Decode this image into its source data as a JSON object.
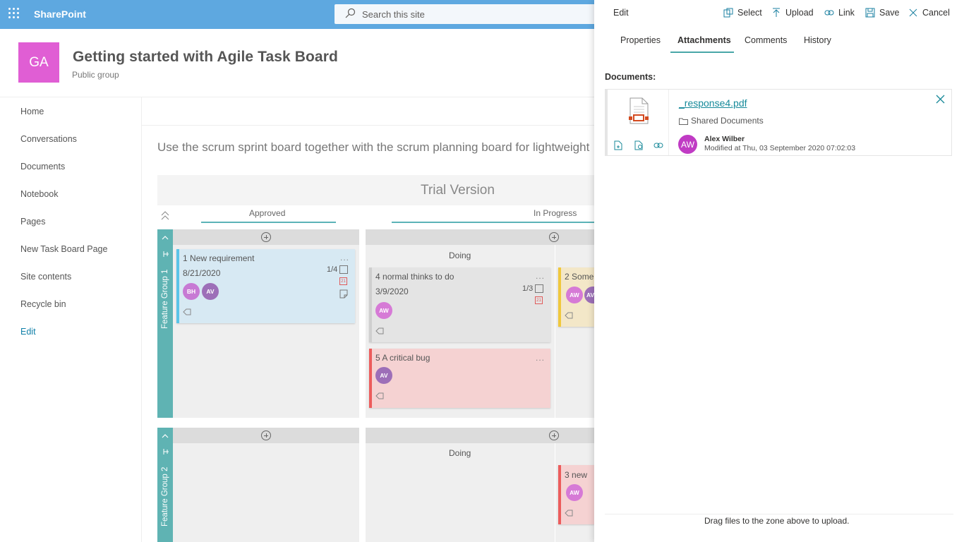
{
  "suite": {
    "brand": "SharePoint",
    "search_placeholder": "Search this site"
  },
  "site": {
    "logo_initials": "GA",
    "title": "Getting started with Agile Task Board",
    "subtitle": "Public group"
  },
  "nav": {
    "items": [
      "Home",
      "Conversations",
      "Documents",
      "Notebook",
      "Pages",
      "New Task Board Page",
      "Site contents",
      "Recycle bin"
    ],
    "edit": "Edit"
  },
  "main": {
    "intro": "Use the scrum sprint board together with the scrum planning board for lightweight",
    "trial": "Trial Version",
    "columns": [
      "Approved",
      "In Progress"
    ],
    "groups": [
      "Feature Group 1",
      "Feature Group 2"
    ],
    "sub_column": "Doing",
    "cards": [
      {
        "num": "1",
        "title": "New requirement",
        "date": "8/21/2020",
        "count": "1/4",
        "avatars": [
          "BH",
          "AV"
        ]
      },
      {
        "num": "4",
        "title": "normal thinks to do",
        "date": "3/9/2020",
        "count": "1/3",
        "avatars": [
          "AW"
        ]
      },
      {
        "num": "5",
        "title": "A critical bug",
        "avatars": [
          "AV"
        ]
      },
      {
        "num": "2",
        "title": "Some",
        "avatars": [
          "AW",
          "AV"
        ]
      },
      {
        "num": "3",
        "title": "new ",
        "avatars": [
          "AW"
        ]
      }
    ],
    "more": "...",
    "cal_day": "21"
  },
  "panel": {
    "edit": "Edit",
    "commands": {
      "select": "Select",
      "upload": "Upload",
      "link": "Link",
      "save": "Save",
      "cancel": "Cancel"
    },
    "tabs": [
      "Properties",
      "Attachments",
      "Comments",
      "History"
    ],
    "active_tab": "Attachments",
    "documents_label": "Documents:",
    "file": {
      "name": "_response4.pdf",
      "folder": "Shared Documents",
      "author_initials": "AW",
      "author": "Alex Wilber",
      "modified": "Modified at Thu, 03 September 2020 07:02:03"
    },
    "drop_hint": "Drag files to the zone above to upload."
  },
  "colors": {
    "suite_bar": "#5ea8e0",
    "accent_teal": "#5fb3b3",
    "logo": "#e05ed4",
    "author_avatar": "#c03bc4"
  }
}
